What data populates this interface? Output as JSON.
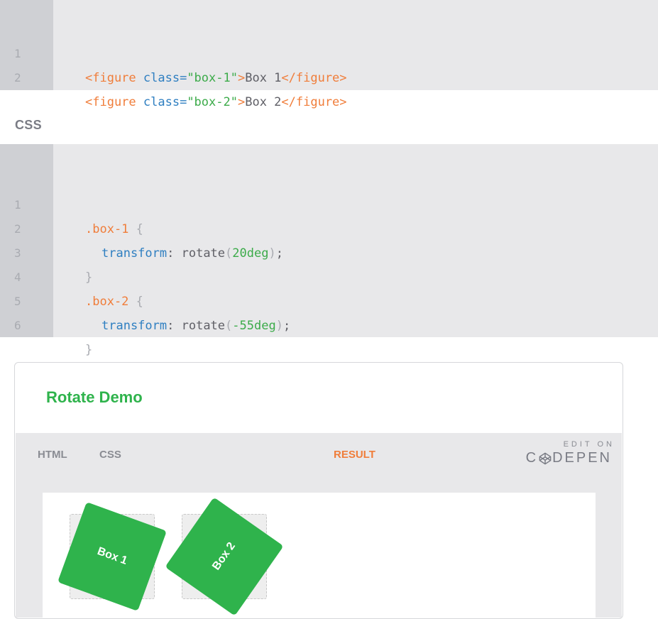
{
  "html_code": {
    "lines": [
      {
        "num": "1",
        "tag_open": "<figure ",
        "attr": "class=",
        "str": "\"box-1\"",
        "tag_close": ">",
        "text": "Box 1",
        "end_tag": "</figure>"
      },
      {
        "num": "2",
        "tag_open": "<figure ",
        "attr": "class=",
        "str": "\"box-2\"",
        "tag_close": ">",
        "text": "Box 2",
        "end_tag": "</figure>"
      }
    ]
  },
  "css_label": "CSS",
  "css_code": {
    "lines": [
      {
        "num": "1",
        "sel": ".box-1",
        "open": " {"
      },
      {
        "num": "2",
        "prop": "transform",
        "colon": ": ",
        "fn": "rotate",
        "lp": "(",
        "val": "20deg",
        "rp": ")",
        "semi": ";"
      },
      {
        "num": "3",
        "close": "}"
      },
      {
        "num": "4",
        "sel": ".box-2",
        "open": " {"
      },
      {
        "num": "5",
        "prop": "transform",
        "colon": ": ",
        "fn": "rotate",
        "lp": "(",
        "val": "-55deg",
        "rp": ")",
        "semi": ";"
      },
      {
        "num": "6",
        "close": "}"
      }
    ]
  },
  "demo": {
    "title": "Rotate Demo",
    "tabs": {
      "html": "HTML",
      "css": "CSS",
      "result": "RESULT"
    },
    "edit_on": "EDIT ON",
    "logo_left": "C",
    "logo_right": "DEPEN",
    "boxes": [
      "Box 1",
      "Box 2"
    ],
    "colors": {
      "accent": "#2fb34c",
      "active_tab": "#f07d3a"
    }
  }
}
